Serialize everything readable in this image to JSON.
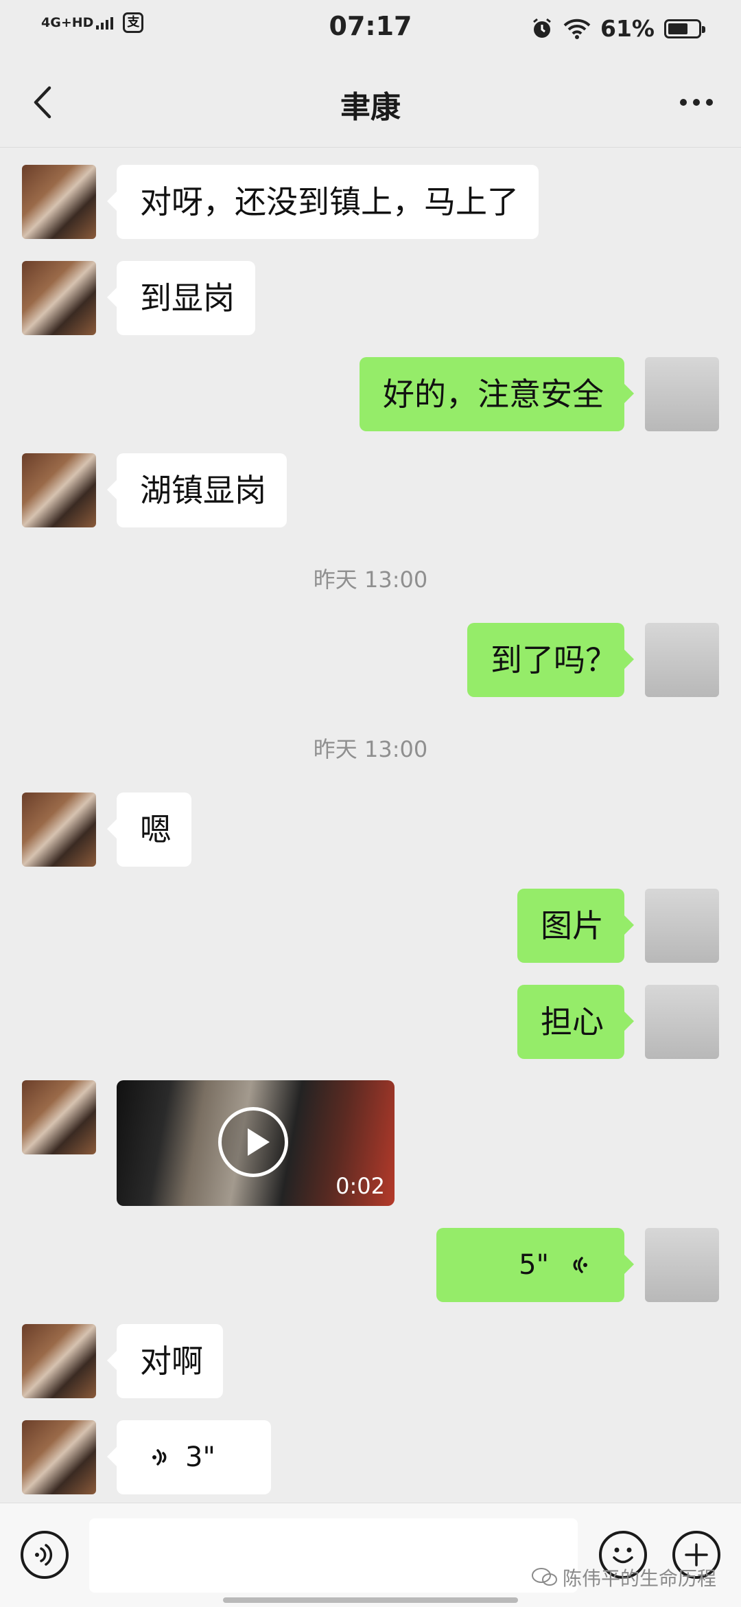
{
  "status_bar": {
    "network": "4G+HD",
    "time": "07:17",
    "battery_text": "61%",
    "battery_level": 0.61
  },
  "nav": {
    "title": "聿康"
  },
  "messages": [
    {
      "side": "in",
      "text": "对呀，还没到镇上，马上了"
    },
    {
      "side": "in",
      "text": "到显岗"
    },
    {
      "side": "out",
      "text": "好的，注意安全"
    },
    {
      "side": "in",
      "text": "湖镇显岗"
    },
    {
      "type": "timestamp",
      "text": "昨天 13:00"
    },
    {
      "side": "out",
      "text": "到了吗？"
    },
    {
      "type": "timestamp",
      "text": "昨天 13:00"
    },
    {
      "side": "in",
      "text": "嗯"
    },
    {
      "side": "out",
      "text": "图片"
    },
    {
      "side": "out",
      "text": "担心"
    },
    {
      "side": "in",
      "type": "video",
      "duration": "0:02"
    },
    {
      "side": "out",
      "type": "voice",
      "duration": "5\""
    },
    {
      "side": "in",
      "text": "对啊"
    },
    {
      "side": "in",
      "type": "voice",
      "duration": "3\""
    }
  ],
  "input": {
    "placeholder": ""
  },
  "watermark": {
    "text": "陈伟平的生命历程"
  },
  "colors": {
    "background": "#ededed",
    "outgoing_bubble": "#95ec69",
    "incoming_bubble": "#ffffff"
  }
}
